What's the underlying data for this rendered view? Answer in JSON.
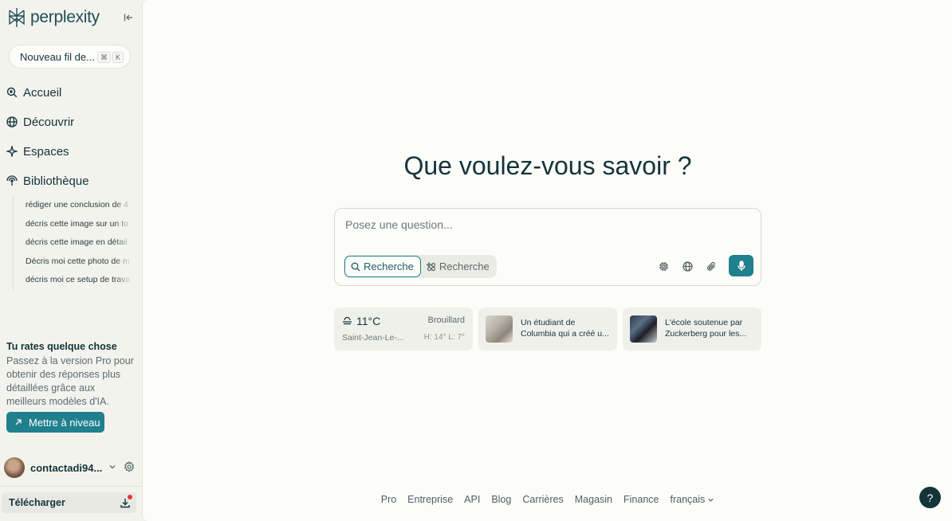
{
  "brand": {
    "name": "perplexity",
    "accent": "#20808d"
  },
  "sidebar": {
    "new_thread": {
      "label": "Nouveau fil de...",
      "shortcut": [
        "⌘",
        "K"
      ]
    },
    "nav": [
      {
        "label": "Accueil",
        "icon": "search-icon"
      },
      {
        "label": "Découvrir",
        "icon": "globe-icon"
      },
      {
        "label": "Espaces",
        "icon": "sparkle-icon"
      },
      {
        "label": "Bibliothèque",
        "icon": "library-icon"
      }
    ],
    "library_items": [
      "rédiger une conclusion de 4",
      "décris cette image sur un to",
      "décris cette image en détail",
      "Décris moi cette photo de m",
      "décris moi ce setup de trava"
    ],
    "promo": {
      "title": "Tu rates quelque chose",
      "body": "Passez à la version Pro pour obtenir des réponses plus détaillées grâce aux meilleurs modèles d'IA.",
      "button": "Mettre à niveau"
    },
    "user": {
      "name": "contactadi94..."
    },
    "download_label": "Télécharger"
  },
  "main": {
    "headline": "Que voulez-vous savoir ?",
    "ask": {
      "placeholder": "Posez une question...",
      "modes": [
        "Recherche",
        "Recherche"
      ]
    },
    "weather": {
      "temp": "11°C",
      "condition": "Brouillard",
      "city": "Saint-Jean-Le-...",
      "high_low": "H: 14° L: 7°"
    },
    "news": [
      {
        "line1": "Un étudiant de",
        "line2": "Columbia qui a créé u..."
      },
      {
        "line1": "L'école soutenue par",
        "line2": "Zuckerberg pour les..."
      }
    ],
    "footer_links": [
      "Pro",
      "Entreprise",
      "API",
      "Blog",
      "Carrières",
      "Magasin",
      "Finance",
      "français"
    ],
    "help_label": "?"
  }
}
